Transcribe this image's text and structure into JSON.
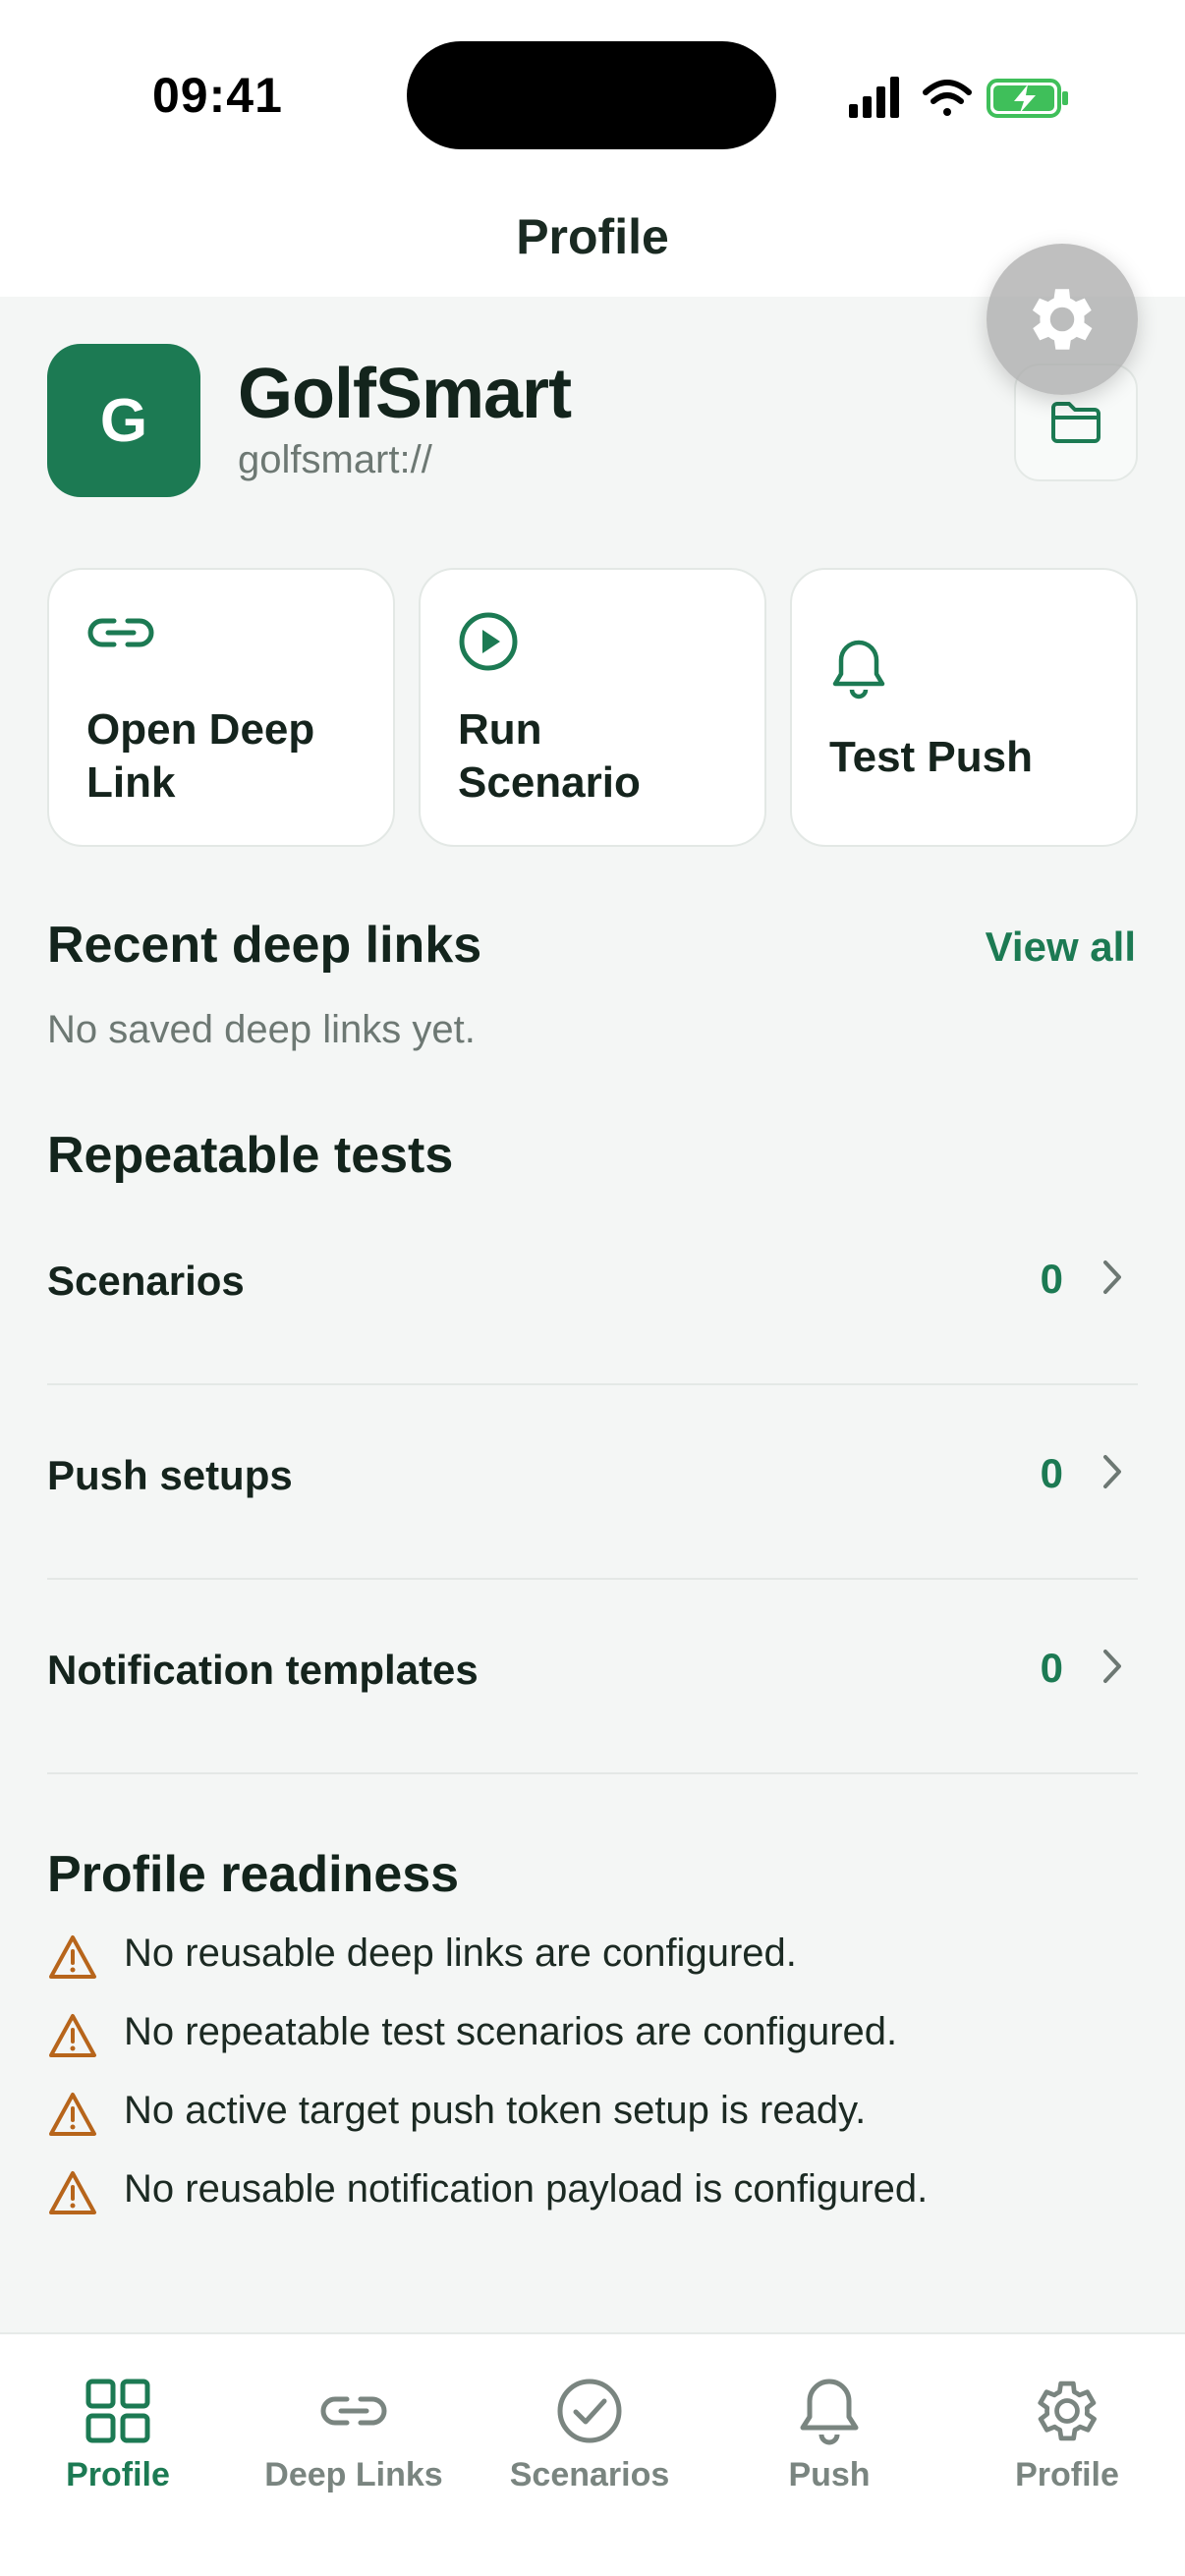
{
  "status_bar": {
    "time": "09:41"
  },
  "nav": {
    "title": "Profile"
  },
  "app": {
    "avatar_letter": "G",
    "name": "GolfSmart",
    "scheme": "golfsmart://"
  },
  "actions": [
    {
      "label_line1": "Open Deep",
      "label_line2": "Link",
      "icon": "link-icon"
    },
    {
      "label_line1": "Run",
      "label_line2": "Scenario",
      "icon": "play-circle-icon"
    },
    {
      "label": "Test Push",
      "icon": "bell-icon"
    }
  ],
  "recent": {
    "title": "Recent deep links",
    "view_all": "View all",
    "empty": "No saved deep links yet."
  },
  "repeatable": {
    "title": "Repeatable tests",
    "rows": [
      {
        "label": "Scenarios",
        "count": "0"
      },
      {
        "label": "Push setups",
        "count": "0"
      },
      {
        "label": "Notification templates",
        "count": "0"
      }
    ]
  },
  "readiness": {
    "title": "Profile readiness",
    "items": [
      "No reusable deep links are configured.",
      "No repeatable test scenarios are configured.",
      "No active target push token setup is ready.",
      "No reusable notification payload is configured."
    ]
  },
  "tabs": [
    {
      "label": "Profile",
      "icon": "grid-icon",
      "active": true
    },
    {
      "label": "Deep Links",
      "icon": "link-icon",
      "active": false
    },
    {
      "label": "Scenarios",
      "icon": "check-circle-icon",
      "active": false
    },
    {
      "label": "Push",
      "icon": "bell-icon",
      "active": false
    },
    {
      "label": "Profile",
      "icon": "gear-icon",
      "active": false
    }
  ],
  "colors": {
    "accent": "#1c7a53",
    "warning": "#b7651b",
    "background": "#f4f6f5"
  }
}
